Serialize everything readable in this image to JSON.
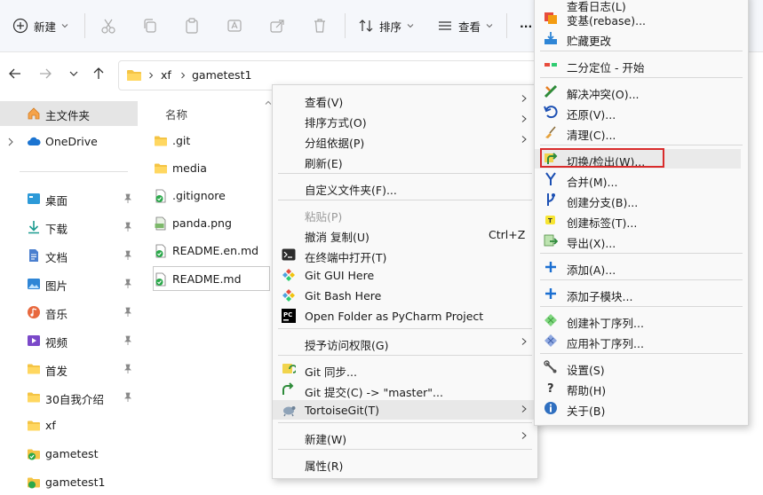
{
  "toolbar": {
    "new_label": "新建",
    "sort_label": "排序",
    "view_label": "查看",
    "more_label": "···"
  },
  "address": {
    "path": [
      "xf",
      "gametest1"
    ]
  },
  "sidebar": {
    "items": [
      {
        "label": "主文件夹",
        "icon": "home-icon"
      },
      {
        "label": "OneDrive",
        "icon": "cloud-icon"
      },
      {
        "label": "桌面",
        "icon": "desktop-icon"
      },
      {
        "label": "下载",
        "icon": "download-icon"
      },
      {
        "label": "文档",
        "icon": "document-icon"
      },
      {
        "label": "图片",
        "icon": "picture-icon"
      },
      {
        "label": "音乐",
        "icon": "music-icon"
      },
      {
        "label": "视频",
        "icon": "video-icon"
      },
      {
        "label": "首发",
        "icon": "folder-icon"
      },
      {
        "label": "30自我介绍",
        "icon": "folder-icon"
      },
      {
        "label": "xf",
        "icon": "folder-icon"
      },
      {
        "label": "gametest",
        "icon": "git-folder-icon"
      },
      {
        "label": "gametest1",
        "icon": "git-folder-icon"
      }
    ]
  },
  "files": {
    "column_name": "名称",
    "items": [
      {
        "name": ".git",
        "icon": "folder-icon"
      },
      {
        "name": "media",
        "icon": "folder-icon"
      },
      {
        "name": ".gitignore",
        "icon": "git-file-icon"
      },
      {
        "name": "panda.png",
        "icon": "png-icon"
      },
      {
        "name": "README.en.md",
        "icon": "git-file-icon"
      },
      {
        "name": "README.md",
        "icon": "git-file-icon"
      }
    ]
  },
  "context_menu": {
    "view": "查看(V)",
    "sort_by": "排序方式(O)",
    "group_by": "分组依据(P)",
    "refresh": "刷新(E)",
    "customize_folder": "自定义文件夹(F)...",
    "paste": "粘贴(P)",
    "undo_copy": "撤消 复制(U)",
    "undo_shortcut": "Ctrl+Z",
    "open_terminal": "在终端中打开(T)",
    "git_gui": "Git GUI Here",
    "git_bash": "Git Bash Here",
    "pycharm": "Open Folder as PyCharm Project",
    "grant_access": "授予访问权限(G)",
    "git_sync": "Git 同步...",
    "git_commit": "Git 提交(C) -> \"master\"...",
    "tortoisegit": "TortoiseGit(T)",
    "new": "新建(W)",
    "properties": "属性(R)"
  },
  "submenu": {
    "partial_top": "查看日志(L)",
    "rebase": "变基(rebase)...",
    "stash": "贮藏更改",
    "bisect": "二分定位 - 开始",
    "resolve": "解决冲突(O)...",
    "revert": "还原(V)...",
    "clean": "清理(C)...",
    "switch_checkout": "切换/检出(W)...",
    "merge": "合并(M)...",
    "create_branch": "创建分支(B)...",
    "create_tag": "创建标签(T)...",
    "export": "导出(X)...",
    "add": "添加(A)...",
    "add_submodule": "添加子模块...",
    "create_patch": "创建补丁序列...",
    "apply_patch": "应用补丁序列...",
    "settings": "设置(S)",
    "help": "帮助(H)",
    "about": "关于(B)"
  },
  "colors": {
    "highlight_border": "#d92b2b",
    "selection": "#e5e5e5",
    "accent": "#0f6cbd"
  }
}
